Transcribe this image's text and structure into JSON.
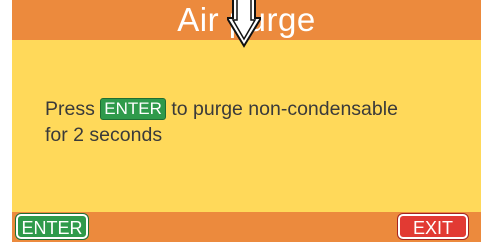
{
  "header": {
    "title": "Air purge"
  },
  "message": {
    "prefix": "Press",
    "key_label": "ENTER",
    "suffix": "to purge non-condensable",
    "line2": "for 2 seconds"
  },
  "softkeys": {
    "enter_label": "ENTER",
    "exit_label": "EXIT"
  },
  "colors": {
    "screen_bg": "#ffd95a",
    "header_bg": "#ec8a3d",
    "enter_green": "#2f9a4b",
    "exit_red": "#e23a33"
  },
  "icons": {
    "cursor": "hand-pointer-outline-icon"
  }
}
